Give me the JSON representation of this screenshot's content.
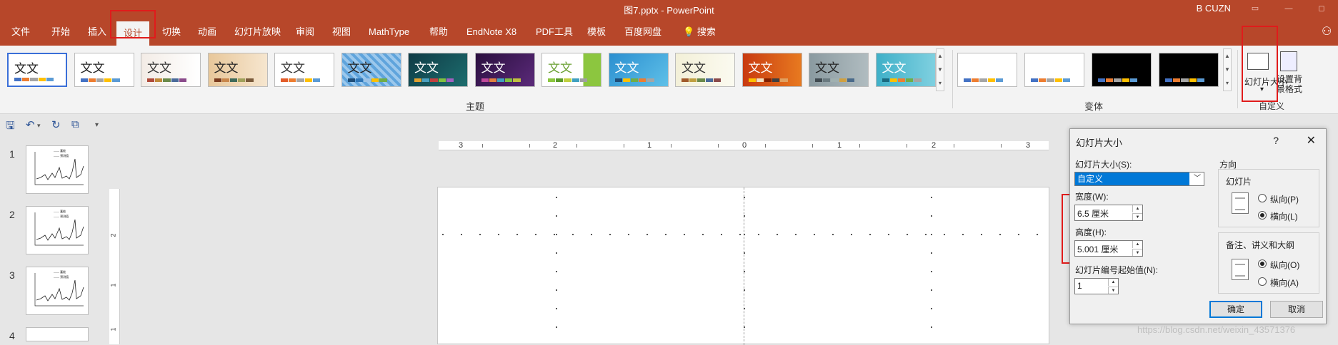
{
  "window": {
    "title": "图7.pptx  -  PowerPoint",
    "user": "B CUZN",
    "controls": [
      "▭",
      "—",
      "◻"
    ]
  },
  "tabs": [
    "文件",
    "开始",
    "插入",
    "设计",
    "切换",
    "动画",
    "幻灯片放映",
    "审阅",
    "视图",
    "MathType",
    "帮助",
    "EndNote X8",
    "PDF工具",
    "模板",
    "百度网盘",
    "搜索"
  ],
  "active_tab": "设计",
  "ribbon": {
    "theme_sample_text": "文文",
    "theme_group_label": "主题",
    "variant_group_label": "变体",
    "customize_group_label": "自定义",
    "slide_size_button": "幻灯片大小",
    "slide_size_arrow": "▾",
    "format_bg_button": "设置背景格式",
    "gallery_scroll": [
      "▲",
      "▼",
      "▾"
    ]
  },
  "qat_icons": [
    "save-icon",
    "undo-icon",
    "redo-icon",
    "present-icon",
    "customize-icon"
  ],
  "slides": [
    {
      "number": "1",
      "legend": [
        "—— 蓄能",
        "—— 预测值"
      ]
    },
    {
      "number": "2",
      "legend": [
        "—— 蓄能",
        "—— 预测值"
      ]
    },
    {
      "number": "3",
      "legend": [
        "—— 蓄能",
        "—— 预测值"
      ]
    },
    {
      "number": "4",
      "legend": []
    }
  ],
  "ruler": {
    "horizontal": [
      "3",
      "2",
      "1",
      "0",
      "1",
      "2",
      "3"
    ],
    "vertical": [
      "2",
      "1",
      "1"
    ]
  },
  "dialog": {
    "title": "幻灯片大小",
    "help": "?",
    "close": "✕",
    "slide_size_label": "幻灯片大小(S):",
    "slide_size_value": "自定义",
    "width_label": "宽度(W):",
    "width_value": "6.5 厘米",
    "height_label": "高度(H):",
    "height_value": "5.001 厘米",
    "start_label": "幻灯片编号起始值(N):",
    "start_value": "1",
    "orientation_title": "方向",
    "slides_section": "幻灯片",
    "portrait": "纵向(P)",
    "landscape": "横向(L)",
    "notes_section": "备注、讲义和大纲",
    "notes_portrait": "纵向(O)",
    "notes_landscape": "横向(A)",
    "ok": "确定",
    "cancel": "取消"
  },
  "watermark": "https://blog.csdn.net/weixin_43571376",
  "colors": {
    "accent": "#b7472a",
    "annotation": "#e01b1b",
    "selection": "#0078d7"
  }
}
